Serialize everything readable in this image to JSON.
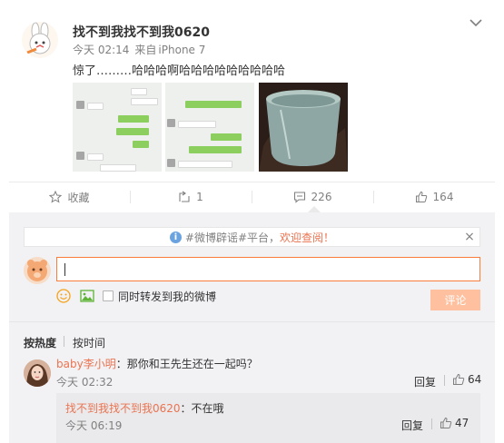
{
  "post": {
    "author": "找不到我找不到我0620",
    "time": "今天 02:14",
    "source_prefix": "来自",
    "source": "iPhone 7",
    "text": "惊了………哈哈哈啊哈哈哈哈哈哈哈哈哈"
  },
  "actions": {
    "favorite": "收藏",
    "repost_count": "1",
    "comment_count": "226",
    "like_count": "164"
  },
  "notice": {
    "prefix": "#微博辟谣#平台，",
    "highlight": "欢迎查阅！",
    "close": "×"
  },
  "composer": {
    "input_value": "",
    "forward_label": "同时转发到我的微博",
    "submit_label": "评论"
  },
  "sort": {
    "hot": "按热度",
    "time": "按时间"
  },
  "comments": [
    {
      "nick": "baby李小明",
      "text": "：那你和王先生还在一起吗？",
      "time": "今天 02:32",
      "reply_label": "回复",
      "likes": "64",
      "reply": {
        "nick": "找不到我找不到我0620",
        "text": "：不在哦",
        "time": "今天 06:19",
        "reply_label": "回复",
        "likes": "47"
      }
    }
  ],
  "colors": {
    "accent": "#eb7350",
    "input_border": "#fa7d3c",
    "submit_bg": "#ffc09f",
    "comment_bg": "#f2f2f5"
  },
  "icons": {
    "favorite": "star-icon",
    "repost": "repost-icon",
    "comment": "comment-icon",
    "like": "thumbs-up-icon",
    "more": "chevron-down-icon",
    "notice": "info-icon",
    "emoji": "emoji-icon",
    "picture": "picture-icon"
  }
}
